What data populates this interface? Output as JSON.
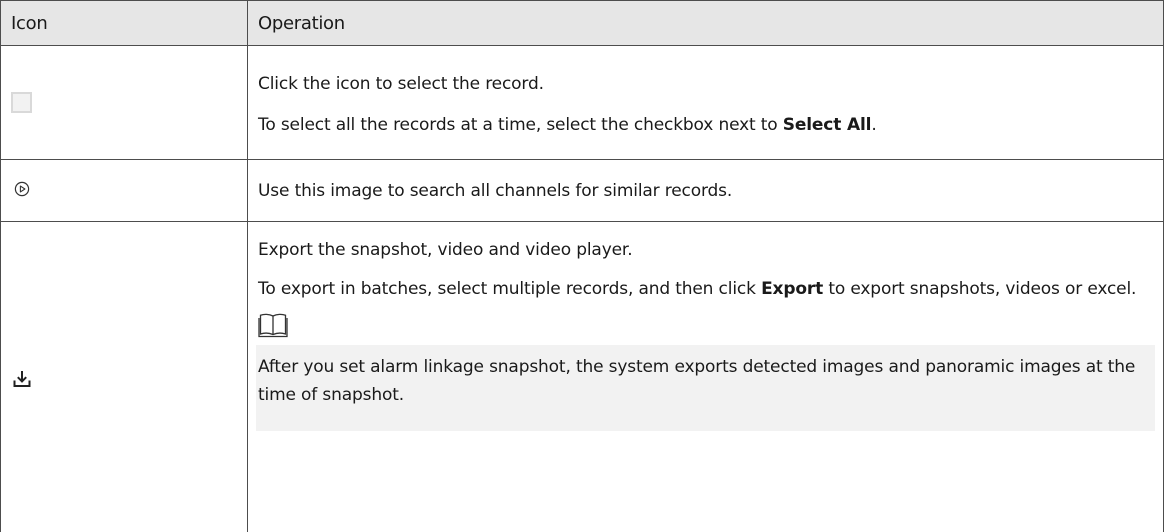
{
  "table": {
    "headers": {
      "icon": "Icon",
      "operation": "Operation"
    },
    "rows": [
      {
        "icon": "checkbox-icon",
        "line1": "Click the icon to select the record.",
        "line2_pre": "To select all the records at a time, select the checkbox next to ",
        "line2_bold": "Select All",
        "line2_post": "."
      },
      {
        "icon": "search-similar-icon",
        "line1": "Use this image to search all channels for similar records."
      },
      {
        "icon": "download-icon",
        "line1": "Export the snapshot, video and video player.",
        "line2_pre": "To export in batches, select multiple records, and then click ",
        "line2_bold": "Export",
        "line2_post": "  to export snapshots, videos or excel.",
        "note_icon": "book-icon",
        "note_text": "After you set alarm linkage snapshot, the system exports detected images and panoramic images at the time of snapshot."
      }
    ]
  },
  "colors": {
    "header_bg": "#e6e6e6",
    "note_bg": "#f2f2f2",
    "border": "#4d4d4d"
  }
}
